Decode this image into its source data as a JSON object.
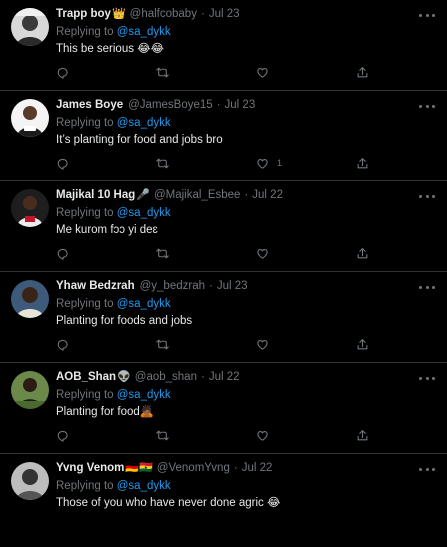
{
  "replying_prefix": "Replying to",
  "tweets": [
    {
      "name": "Trapp boy",
      "emoji": "👑",
      "handle": "@halfcobaby",
      "dot": "·",
      "date": "Jul 23",
      "reply_to": "@sa_dykk",
      "text": "This be serious 😂😂",
      "like_count": ""
    },
    {
      "name": "James Boye",
      "emoji": "",
      "handle": "@JamesBoye15",
      "dot": "·",
      "date": "Jul 23",
      "reply_to": "@sa_dykk",
      "text": "It’s planting for food and jobs bro",
      "like_count": "1"
    },
    {
      "name": "Majikal 10 Hag",
      "emoji": "🎤",
      "handle": "@Majikal_Esbee",
      "dot": "·",
      "date": "Jul 22",
      "reply_to": "@sa_dykk",
      "text": "Me kurom fɔɔ yi deɛ",
      "like_count": ""
    },
    {
      "name": "Yhaw Bedzrah",
      "emoji": "",
      "handle": "@y_bedzrah",
      "dot": "·",
      "date": "Jul 23",
      "reply_to": "@sa_dykk",
      "text": "Planting for foods and jobs",
      "like_count": ""
    },
    {
      "name": "AOB_Shan",
      "emoji": "👽",
      "handle": "@aob_shan",
      "dot": "·",
      "date": "Jul 22",
      "reply_to": "@sa_dykk",
      "text": "Planting for food🙇🏾",
      "like_count": ""
    },
    {
      "name": "Yvng Venom",
      "emoji": "🇩🇪🇬🇭",
      "handle": "@VenomYvng",
      "dot": "·",
      "date": "Jul 22",
      "reply_to": "@sa_dykk",
      "text": "Those of you who have never done agric 😂",
      "like_count": ""
    }
  ],
  "icons": {
    "reply": "reply-icon",
    "retweet": "retweet-icon",
    "like": "heart-icon",
    "share": "share-icon",
    "more": "more-icon"
  },
  "colors": {
    "background": "#000000",
    "text": "#e7e9ea",
    "muted": "#71767b",
    "link": "#1d9bf0",
    "border": "#2f3336"
  }
}
